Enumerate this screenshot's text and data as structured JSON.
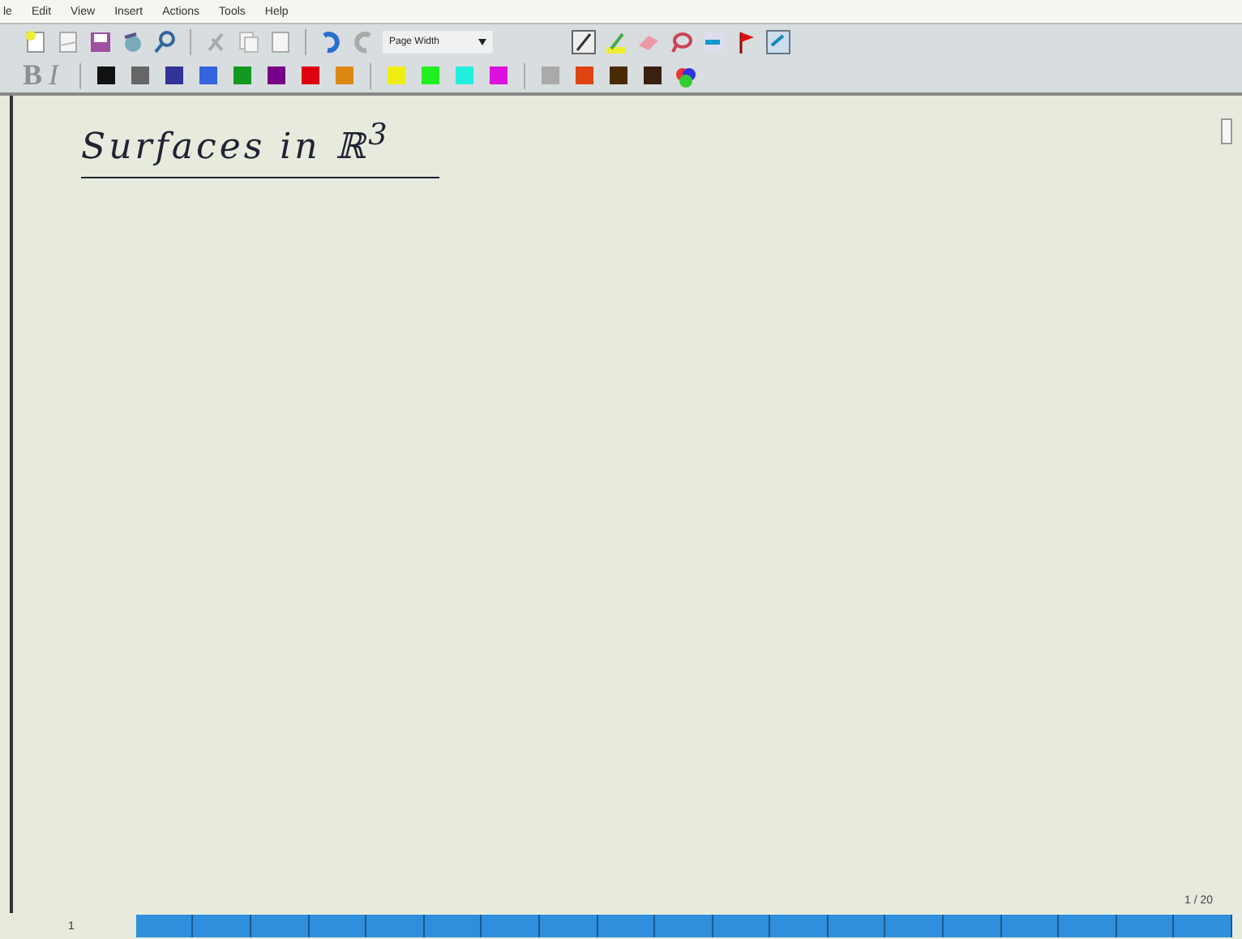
{
  "menu_bar": [
    "le",
    "Edit",
    "View",
    "Insert",
    "Actions",
    "Tools",
    "Help"
  ],
  "toolbar": {
    "zoom_dropdown": "Page Width"
  },
  "format_bar": {
    "bold": "B",
    "italic": "I",
    "colors": [
      {
        "color": "#111111"
      },
      {
        "color": "#666666"
      },
      {
        "color": "#333399"
      },
      {
        "color": "#3366dd"
      },
      {
        "color": "#119922"
      },
      {
        "color": "#770088"
      },
      {
        "color": "#dd0011"
      },
      {
        "color": "#dd8811"
      },
      {
        "color": "#eeee11"
      },
      {
        "color": "#22ee22"
      },
      {
        "color": "#22eedd"
      },
      {
        "color": "#dd11dd"
      },
      {
        "color": "#aaaaaa"
      },
      {
        "color": "#dd4411"
      },
      {
        "color": "#4a2a00"
      },
      {
        "color": "#3a2010"
      }
    ]
  },
  "page": {
    "title": "Surfaces in ℝ$^{3}$",
    "page_counter": "1 / 20"
  },
  "status_bar": {
    "page_number": "1"
  }
}
